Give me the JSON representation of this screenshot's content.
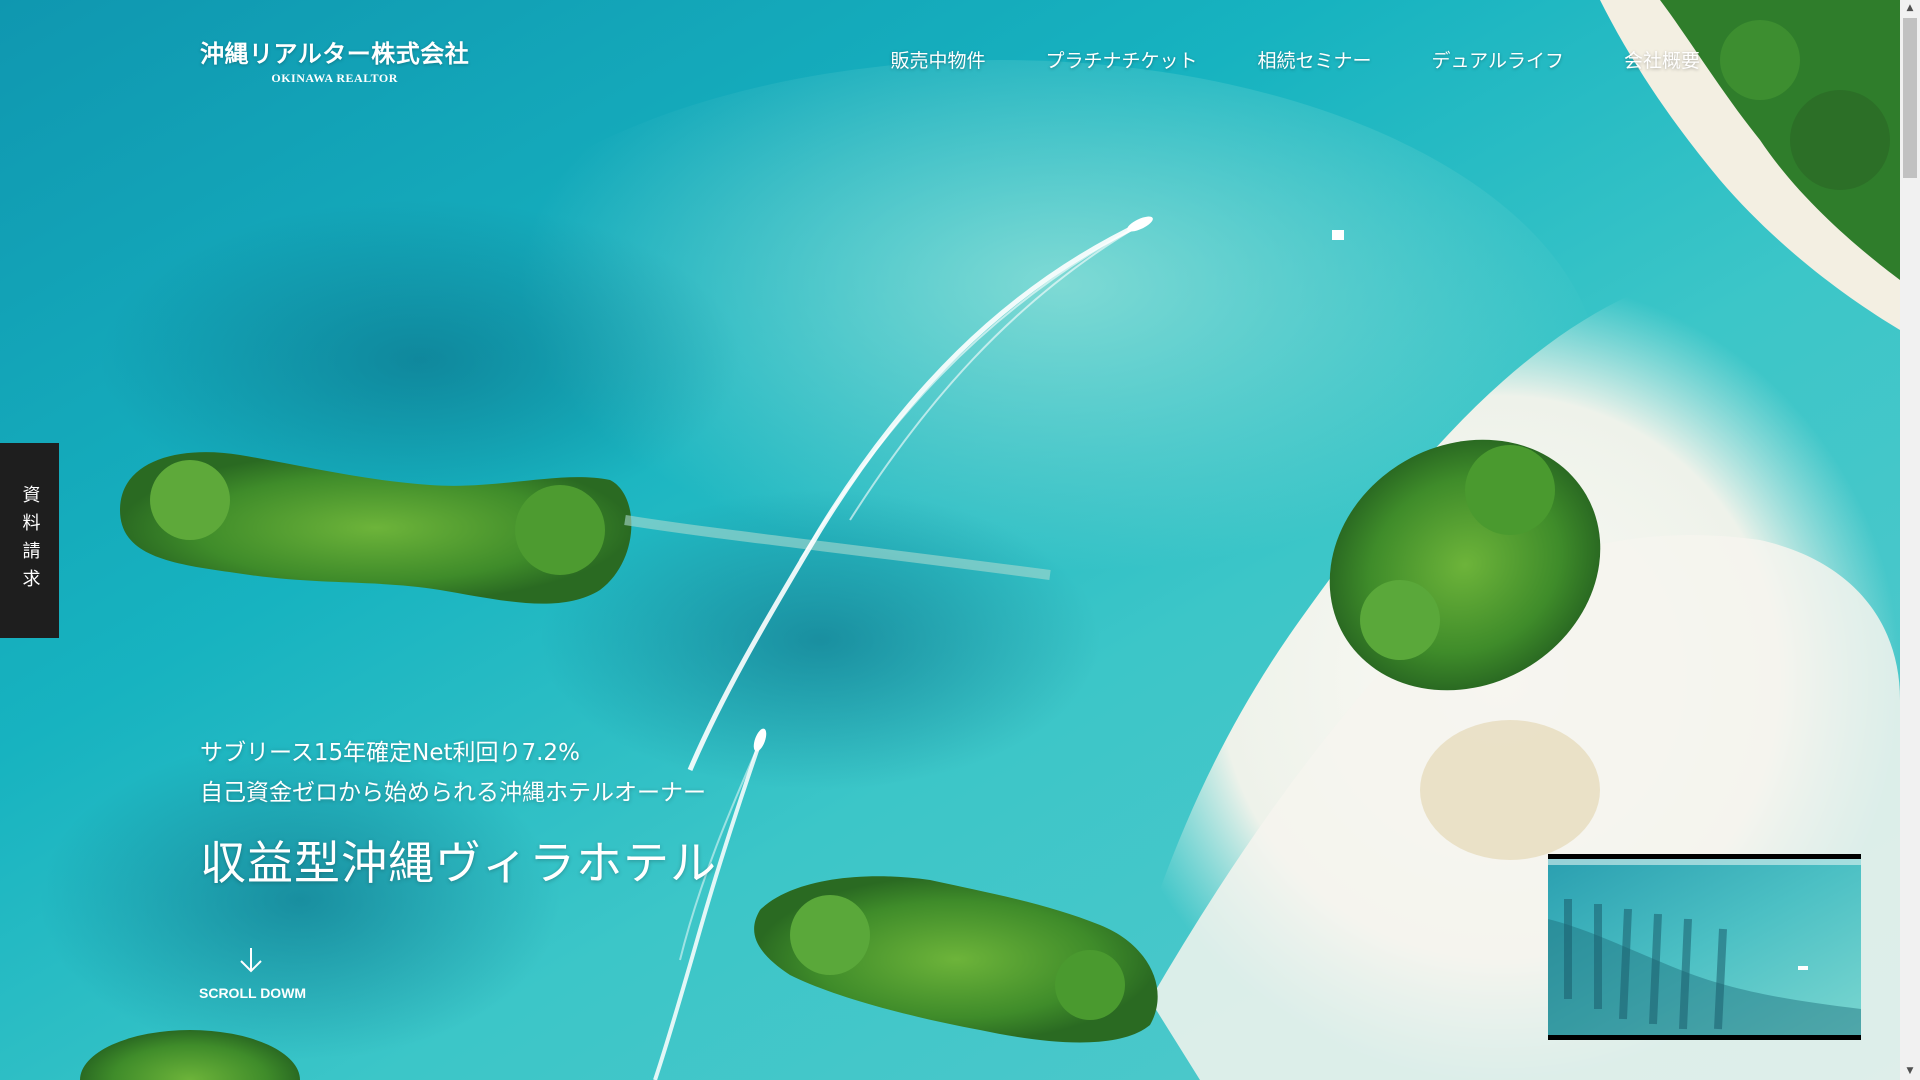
{
  "header": {
    "logo_jp": "沖縄リアルター株式会社",
    "logo_en": "OKINAWA REALTOR"
  },
  "nav": {
    "items": [
      {
        "label": "販売中物件"
      },
      {
        "label": "プラチナチケット"
      },
      {
        "label": "相続セミナー"
      },
      {
        "label": "デュアルライフ"
      },
      {
        "label": "会社概要"
      }
    ]
  },
  "side_tab": {
    "label": "資料請求"
  },
  "hero": {
    "line1": "サブリース15年確定Net利回り7.2%",
    "line2": "自己資金ゼロから始められる沖縄ホテルオーナー",
    "title": "収益型沖縄ヴィラホテル"
  },
  "scroll": {
    "label": "SCROLL DOWM"
  },
  "colors": {
    "sea_deep": "#0a8ea6",
    "sea_light": "#5ed3d4",
    "sand": "#f2f1ea",
    "forest": "#3e8a2c",
    "side_tab_bg": "#1e1e1e"
  }
}
